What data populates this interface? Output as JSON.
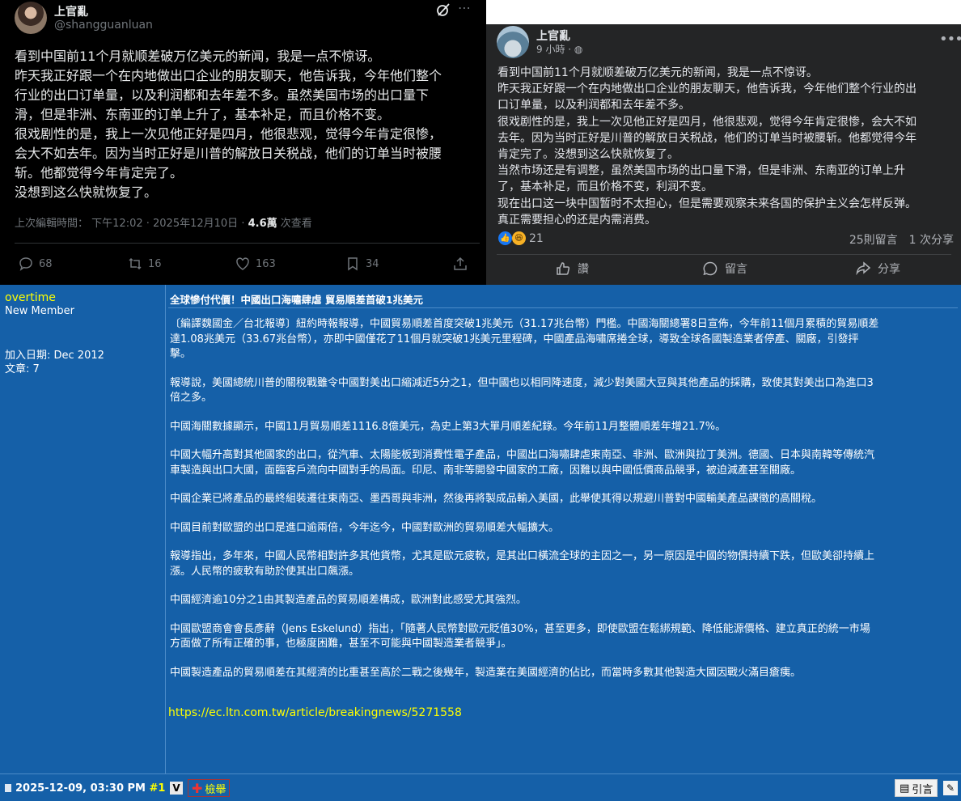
{
  "x_post": {
    "name": "上官亂",
    "handle": "@shangguanluan",
    "lines": [
      "看到中国前11个月就顺差破万亿美元的新闻，我是一点不惊讶。",
      "昨天我正好跟一个在内地做出口企业的朋友聊天，他告诉我，今年他们整个",
      "行业的出口订单量，以及利润都和去年差不多。虽然美国市场的出口量下",
      "滑，但是非洲、东南亚的订单上升了，基本补足，而且价格不变。",
      "很戏剧性的是，我上一次见他正好是四月，他很悲观，觉得今年肯定很惨，",
      "会大不如去年。因为当时正好是川普的解放日关税战，他们的订单当时被腰",
      "斩。他都觉得今年肯定完了。",
      "没想到这么快就恢复了。"
    ],
    "edited_label": "上次編輯時間：",
    "timestamp": "下午12:02 · 2025年12月10日 · ",
    "views_count": "4.6萬",
    "views_label": " 次查看",
    "replies": "68",
    "reposts": "16",
    "likes": "163",
    "bookmarks": "34"
  },
  "fb_post": {
    "name": "上官亂",
    "time": "9 小時 · ",
    "more": "•••",
    "lines": [
      "看到中国前11个月就顺差破万亿美元的新闻，我是一点不惊讶。",
      "昨天我正好跟一个在内地做出口企业的朋友聊天，他告诉我，今年他们整个行业的出",
      "口订单量，以及利润都和去年差不多。",
      "很戏剧性的是，我上一次见他正好是四月，他很悲观，觉得今年肯定很惨，会大不如",
      "去年。因为当时正好是川普的解放日关税战，他们的订单当时被腰斩。他都觉得今年",
      "肯定完了。没想到这么快就恢复了。",
      "当然市场还是有调整，虽然美国市场的出口量下滑，但是非洲、东南亚的订单上升",
      "了，基本补足，而且价格不变，利润不变。",
      "现在出口这一块中国暂时不太担心，但是需要观察未来各国的保护主义会怎样反弹。",
      "真正需要担心的还是内需消费。"
    ],
    "reaction_count": "21",
    "stats": "25則留言　1 次分享",
    "like_label": "讚",
    "comment_label": "留言",
    "share_label": "分享"
  },
  "forum": {
    "username": "overtime",
    "rank": "New Member",
    "join_date": "加入日期: Dec 2012",
    "post_count": "文章: 7",
    "title": "全球慘付代價！中國出口海嘯肆虐 貿易順差首破1兆美元",
    "paragraphs": [
      [
        "〔編譯魏國金／台北報導〕紐約時報報導，中國貿易順差首度突破1兆美元（31.17兆台幣）門檻。中國海關總署8日宣佈，今年前11個月累積的貿易順差",
        "達1.08兆美元（33.67兆台幣），亦即中國僅花了11個月就突破1兆美元里程碑，中國產品海嘯席捲全球，導致全球各國製造業者停產、關廠，引發抨",
        "擊。"
      ],
      [
        "報導說，美國總統川普的關稅戰雖令中國對美出口縮減近5分之1，但中國也以相同降速度，減少對美國大豆與其他產品的採購，致使其對美出口為進口3",
        "倍之多。"
      ],
      [
        "中國海關數據顯示，中國11月貿易順差1116.8億美元，為史上第3大單月順差紀錄。今年前11月整體順差年增21.7%。"
      ],
      [
        "中國大幅升高對其他國家的出口，從汽車、太陽能板到消費性電子產品，中國出口海嘯肆虐東南亞、非洲、歐洲與拉丁美洲。德國、日本與南韓等傳統汽",
        "車製造與出口大國，面臨客戶流向中國對手的局面。印尼、南非等開發中國家的工廠，因難以與中國低價商品競爭，被迫減產甚至關廠。"
      ],
      [
        "中國企業已將產品的最終組裝遷往東南亞、墨西哥與非洲，然後再將製成品輸入美國，此舉使其得以規避川普對中國輸美產品課徵的高關稅。"
      ],
      [
        "中國目前對歐盟的出口是進口逾兩倍，今年迄今，中國對歐洲的貿易順差大幅擴大。"
      ],
      [
        "報導指出，多年來，中國人民幣相對許多其他貨幣，尤其是歐元疲軟，是其出口橫流全球的主因之一，另一原因是中國的物價持續下跌，但歐美卻持續上",
        "漲。人民幣的疲軟有助於使其出口飆漲。"
      ],
      [
        "中國經濟逾10分之1由其製造產品的貿易順差構成，歐洲對此感受尤其強烈。"
      ],
      [
        "中國歐盟商會會長彥辭（Jens Eskelund）指出，「隨著人民幣對歐元貶值30%，甚至更多，即使歐盟在鬆綁規範、降低能源價格、建立真正的統一市場",
        "方面做了所有正確的事，也極度困難，甚至不可能與中國製造業者競爭」。"
      ],
      [
        "中國製造產品的貿易順差在其經濟的比重甚至高於二戰之後幾年，製造業在美國經濟的佔比，而當時多數其他製造大國因戰火滿目瘡痍。"
      ]
    ],
    "link": "https://ec.ltn.com.tw/article/breakingnews/5271558",
    "post_date": "2025-12-09, 03:30 PM ",
    "post_number": "#1",
    "vbtn": "V",
    "report_label": "檢舉",
    "quote_label": "引言",
    "colors": {
      "background": "#1560a8",
      "username": "#ffff00",
      "link": "#ffff00"
    }
  }
}
